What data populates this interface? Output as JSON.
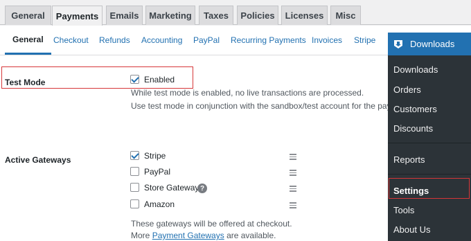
{
  "top_tabs": [
    {
      "label": "General"
    },
    {
      "label": "Payments"
    },
    {
      "label": "Emails"
    },
    {
      "label": "Marketing"
    },
    {
      "label": "Taxes"
    },
    {
      "label": "Policies"
    },
    {
      "label": "Licenses"
    },
    {
      "label": "Misc"
    }
  ],
  "sub_tabs": [
    {
      "label": "General"
    },
    {
      "label": "Checkout"
    },
    {
      "label": "Refunds"
    },
    {
      "label": "Accounting"
    },
    {
      "label": "PayPal"
    },
    {
      "label": "Recurring Payments"
    },
    {
      "label": "Invoices"
    },
    {
      "label": "Stripe"
    }
  ],
  "test_mode": {
    "label": "Test Mode",
    "checkbox_label": "Enabled",
    "checked": true,
    "desc_line1": "While test mode is enabled, no live transactions are processed.",
    "desc_line2": "Use test mode in conjunction with the sandbox/test account for the paym"
  },
  "gateways": {
    "label": "Active Gateways",
    "items": [
      {
        "label": "Stripe",
        "checked": true
      },
      {
        "label": "PayPal",
        "checked": false
      },
      {
        "label": "Store Gateway",
        "checked": false,
        "help": "?"
      },
      {
        "label": "Amazon",
        "checked": false
      }
    ],
    "desc_line1": "These gateways will be offered at checkout.",
    "desc_more": "More",
    "desc_link": "Payment Gateways",
    "desc_tail": "are available."
  },
  "sidebar": {
    "header": "Downloads",
    "items": [
      {
        "label": "Downloads"
      },
      {
        "label": "Orders"
      },
      {
        "label": "Customers"
      },
      {
        "label": "Discounts"
      },
      {
        "label": "Reports"
      },
      {
        "label": "Settings"
      },
      {
        "label": "Tools"
      },
      {
        "label": "About Us"
      }
    ]
  },
  "colors": {
    "accent": "#2271b1",
    "highlight": "#d63638",
    "sidebar": "#2c3338"
  }
}
